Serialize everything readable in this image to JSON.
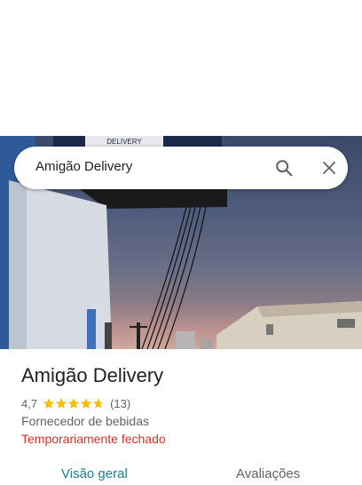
{
  "search": {
    "query": "Amigão Delivery"
  },
  "place": {
    "name": "Amigão Delivery",
    "rating": "4,7",
    "rating_value": 4.7,
    "review_count": "(13)",
    "category": "Fornecedor de bebidas",
    "status": "Temporariamente fechado"
  },
  "photo": {
    "sign_text": "DELIVERY"
  },
  "tabs": [
    {
      "label": "Visão geral",
      "active": true
    },
    {
      "label": "Avaliações",
      "active": false
    }
  ],
  "colors": {
    "accent": "#1a7f8e",
    "closed_status": "#d93025",
    "star": "#fbbc04"
  },
  "icons": {
    "search": "search-icon",
    "close": "close-icon",
    "star": "star-icon"
  }
}
